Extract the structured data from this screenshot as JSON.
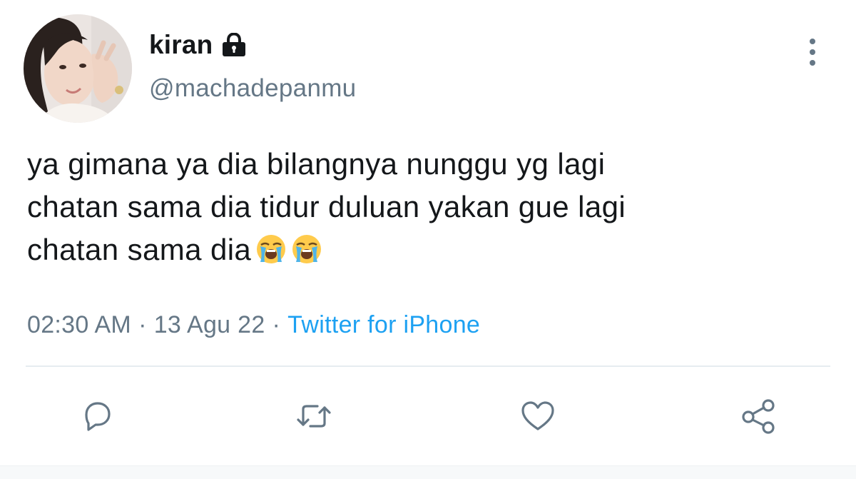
{
  "author": {
    "display_name": "kiran",
    "handle": "@machadepanmu",
    "protected_icon": "lock-icon",
    "avatar_icon": "profile-photo"
  },
  "tweet": {
    "text": "ya gimana ya dia bilangnya nunggu yg lagi\nchatan sama dia tidur duluan yakan gue lagi\nchatan sama dia",
    "emoji": [
      "loudly-crying-face",
      "loudly-crying-face"
    ]
  },
  "meta": {
    "time": "02:30 AM",
    "date": "13 Agu 22",
    "separator": "·",
    "source": "Twitter for iPhone"
  },
  "actions": [
    {
      "name": "reply",
      "icon": "speech-bubble-icon"
    },
    {
      "name": "retweet",
      "icon": "retweet-icon"
    },
    {
      "name": "like",
      "icon": "heart-icon"
    },
    {
      "name": "share",
      "icon": "share-icon"
    }
  ],
  "menu": {
    "icon": "more-vertical-icon"
  },
  "colors": {
    "text": "#14171a",
    "secondary": "#657786",
    "link": "#1da1f2",
    "divider": "#e6ecf0"
  }
}
